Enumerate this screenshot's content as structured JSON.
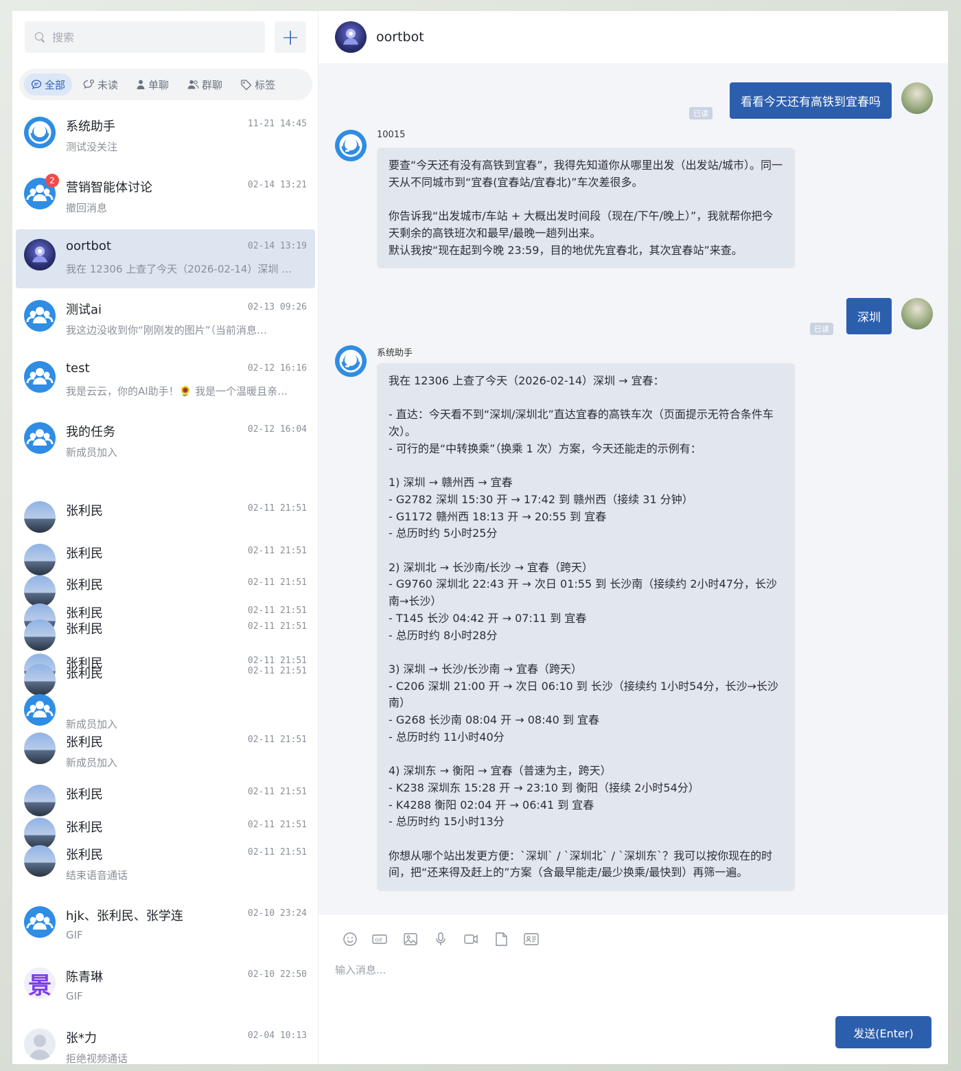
{
  "search": {
    "placeholder": "搜索"
  },
  "filters": [
    {
      "label": "全部",
      "icon": "chat-bubble-icon"
    },
    {
      "label": "未读",
      "icon": "unread-icon"
    },
    {
      "label": "单聊",
      "icon": "person-icon"
    },
    {
      "label": "群聊",
      "icon": "group-icon"
    },
    {
      "label": "标签",
      "icon": "tag-icon"
    }
  ],
  "conversations": [
    {
      "name": "系统助手",
      "time": "11-21 14:45",
      "preview": "测试没关注"
    },
    {
      "name": "营销智能体讨论",
      "time": "02-14 13:21",
      "preview": "撤回消息",
      "badge": "2"
    },
    {
      "name": "oortbot",
      "time": "02-14 13:19",
      "preview": "我在 12306 上查了今天（2026-02-14）深圳 …"
    },
    {
      "name": "测试ai",
      "time": "02-13 09:26",
      "preview": "我这边没收到你“刚刚发的图片”（当前消息…"
    },
    {
      "name": "test",
      "time": "02-12 16:16",
      "preview": "我是云云，你的AI助手！🌻 我是一个温暖且亲…"
    },
    {
      "name": "我的任务",
      "time": "02-12 16:04",
      "preview": "新成员加入"
    },
    {
      "name": "张利民",
      "time": "02-11 21:51",
      "preview": ""
    },
    {
      "name": "张利民",
      "time": "02-11 21:51",
      "preview": ""
    },
    {
      "name": "张利民",
      "time": "02-11 21:51",
      "preview": ""
    },
    {
      "name": "张利民",
      "time": "02-11 21:51",
      "preview": ""
    },
    {
      "name": "张利民",
      "time": "02-11 21:51",
      "preview": ""
    },
    {
      "name": "张利民",
      "time": "02-11 21:51",
      "preview": ""
    },
    {
      "name": "张利民",
      "time": "02-11 21:51",
      "preview": ""
    },
    {
      "name": "",
      "time": "",
      "preview": "新成员加入"
    },
    {
      "name": "张利民",
      "time": "02-11 21:51",
      "preview": "新成员加入"
    },
    {
      "name": "张利民",
      "time": "02-11 21:51",
      "preview": ""
    },
    {
      "name": "张利民",
      "time": "02-11 21:51",
      "preview": ""
    },
    {
      "name": "张利民",
      "time": "02-11 21:51",
      "preview": "结束语音通话"
    },
    {
      "name": "hjk、张利民、张学连",
      "time": "02-10 23:24",
      "preview": "GIF"
    },
    {
      "name": "陈青琳",
      "time": "02-10 22:50",
      "preview": "GIF",
      "avatar_text": "景"
    },
    {
      "name": "张*力",
      "time": "02-04 10:13",
      "preview": "拒绝视频通话"
    }
  ],
  "chat": {
    "title": "oortbot",
    "read_label": "已读",
    "messages": [
      {
        "type": "out",
        "text": "看看今天还有高铁到宜春吗"
      },
      {
        "type": "in",
        "sender": "10015",
        "text": "要查“今天还有没有高铁到宜春”，我得先知道你从哪里出发（出发站/城市）。同一天从不同城市到“宜春(宜春站/宜春北)”车次差很多。\n\n你告诉我“出发城市/车站 + 大概出发时间段（现在/下午/晚上）”，我就帮你把今天剩余的高铁班次和最早/最晚一趟列出来。\n默认我按“现在起到今晚 23:59，目的地优先宜春北，其次宜春站”来查。"
      },
      {
        "type": "out",
        "text": "深圳"
      },
      {
        "type": "in",
        "sender": "系统助手",
        "text": "我在 12306 上查了今天（2026-02-14）深圳 → 宜春：\n\n- 直达：今天看不到“深圳/深圳北”直达宜春的高铁车次（页面提示无符合条件车次）。\n- 可行的是“中转换乘”（换乘 1 次）方案，今天还能走的示例有：\n\n1) 深圳 → 赣州西 → 宜春\n- G2782 深圳 15:30 开 → 17:42 到 赣州西（接续 31 分钟）\n- G1172 赣州西 18:13 开 → 20:55 到 宜春\n- 总历时约 5小时25分\n\n2) 深圳北 → 长沙南/长沙 → 宜春（跨天）\n- G9760 深圳北 22:43 开 → 次日 01:55 到 长沙南（接续约 2小时47分，长沙南→长沙）\n- T145 长沙 04:42 开 → 07:11 到 宜春\n- 总历时约 8小时28分\n\n3) 深圳 → 长沙/长沙南 → 宜春（跨天）\n- C206 深圳 21:00 开 → 次日 06:10 到 长沙（接续约 1小时54分，长沙→长沙南）\n- G268 长沙南 08:04 开 → 08:40 到 宜春\n- 总历时约 11小时40分\n\n4) 深圳东 → 衡阳 → 宜春（普速为主，跨天）\n- K238 深圳东 15:28 开 → 23:10 到 衡阳（接续 2小时54分）\n- K4288 衡阳 02:04 开 → 06:41 到 宜春\n- 总历时约 15小时13分\n\n你想从哪个站出发更方便：`深圳` / `深圳北` / `深圳东`？我可以按你现在的时间，把“还来得及赶上的”方案（含最早能走/最少换乘/最快到）再筛一遍。"
      }
    ]
  },
  "composer": {
    "placeholder": "输入消息...",
    "send_label": "发送(Enter)",
    "tools": [
      "emoji-icon",
      "gif-icon",
      "image-icon",
      "microphone-icon",
      "video-icon",
      "file-icon",
      "contact-card-icon"
    ]
  },
  "colors": {
    "accent": "#2b5fae",
    "badge": "#f04b4b",
    "avatar_blue": "#2f8de4"
  }
}
